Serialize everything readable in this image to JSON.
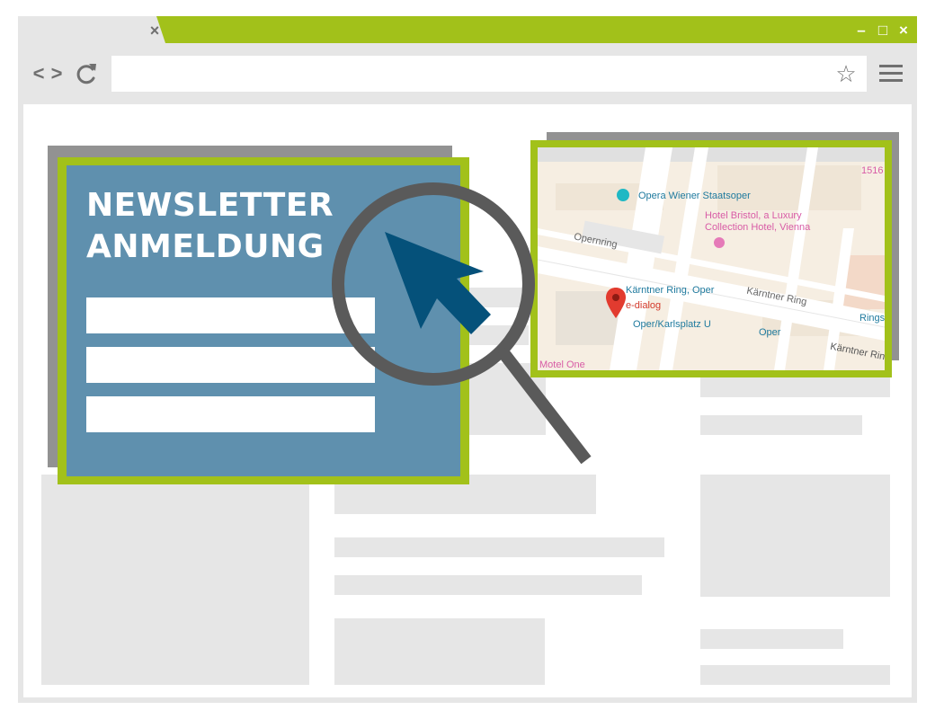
{
  "browser": {
    "tab_close": "×",
    "window_controls": {
      "minimize": "–",
      "maximize": "□",
      "close": "×"
    },
    "nav": {
      "back": "<",
      "forward": ">"
    },
    "bookmark_icon": "☆",
    "accent_color": "#a2c11a"
  },
  "newsletter": {
    "title_line1": "NEWSLETTER",
    "title_line2": "ANMELDUNG",
    "field_count": 3,
    "panel_color": "#5f90ae"
  },
  "map": {
    "labels": {
      "opera": "Opera Wiener Staatsoper",
      "hotel_line1": "Hotel Bristol, a Luxury",
      "hotel_line2": "Collection Hotel, Vienna",
      "opernring": "Opernring",
      "kaerntner_ring_oper": "Kärntner Ring, Oper",
      "kaerntner_ring_street": "Kärntner Ring",
      "kaerntner_ring_right": "Kärntner Ring",
      "e_dialog": "e-dialog",
      "oper_karlsplatz": "Oper/Karlsplatz U",
      "oper": "Oper",
      "motel_one": "Motel One",
      "rings": "Rings",
      "number": "1516"
    }
  },
  "icons": {
    "cursor": "arrow-cursor-icon",
    "magnifier": "magnifier-icon",
    "map_pin": "map-pin-icon"
  }
}
